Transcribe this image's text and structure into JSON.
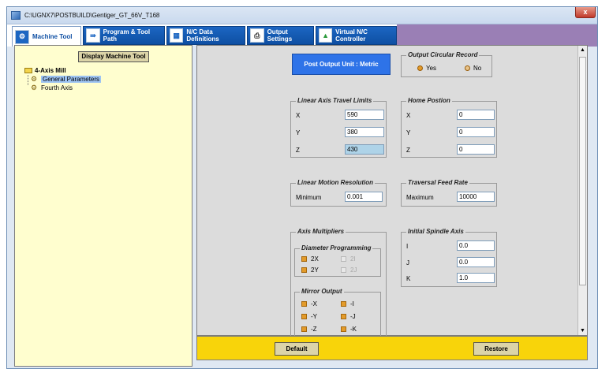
{
  "window": {
    "title": "C:\\UGNX7\\POSTBUILD\\Gentiger_GT_66V_T168",
    "close_label": "x"
  },
  "tabs": [
    {
      "label": "Machine Tool",
      "icon": "machine-tool-icon"
    },
    {
      "label": "Program & Tool Path",
      "icon": "program-icon"
    },
    {
      "label": "N/C Data Definitions",
      "icon": "nc-data-icon"
    },
    {
      "label": "Output Settings",
      "icon": "printer-icon"
    },
    {
      "label": "Virtual N/C Controller",
      "icon": "controller-icon"
    }
  ],
  "left": {
    "display_button": "Display Machine Tool",
    "tree": {
      "root": "4-Axis Mill",
      "children": [
        "General Parameters",
        "Fourth Axis"
      ],
      "selected": "General Parameters"
    }
  },
  "post_output_unit": "Post Output Unit : Metric",
  "circular_record": {
    "title": "Output Circular Record",
    "options": [
      "Yes",
      "No"
    ],
    "selected": "Yes"
  },
  "travel_limits": {
    "title": "Linear Axis Travel Limits",
    "x_label": "X",
    "x": "590",
    "y_label": "Y",
    "y": "380",
    "z_label": "Z",
    "z": "430"
  },
  "home_position": {
    "title": "Home Postion",
    "x_label": "X",
    "x": "0",
    "y_label": "Y",
    "y": "0",
    "z_label": "Z",
    "z": "0"
  },
  "motion_resolution": {
    "title": "Linear Motion Resolution",
    "label": "Minimum",
    "value": "0.001"
  },
  "traversal_feed": {
    "title": "Traversal Feed Rate",
    "label": "Maximum",
    "value": "10000"
  },
  "axis_multipliers": {
    "title": "Axis Multipliers",
    "diameter": {
      "title": "Diameter Programming",
      "items": [
        {
          "label": "2X",
          "enabled": true
        },
        {
          "label": "2I",
          "enabled": false
        },
        {
          "label": "2Y",
          "enabled": true
        },
        {
          "label": "2J",
          "enabled": false
        }
      ]
    },
    "mirror": {
      "title": "Mirror Output",
      "items": [
        "-X",
        "-I",
        "-Y",
        "-J",
        "-Z",
        "-K"
      ]
    }
  },
  "spindle_axis": {
    "title": "Initial Spindle Axis",
    "i_label": "I",
    "i": "0.0",
    "j_label": "J",
    "j": "0.0",
    "k_label": "K",
    "k": "1.0"
  },
  "buttons": {
    "default": "Default",
    "restore": "Restore"
  },
  "colors": {
    "tab_blue": "#1c66c2",
    "accent_yellow": "#f8d40a",
    "unit_button": "#2e73e8",
    "tree_bg": "#fffecf"
  }
}
